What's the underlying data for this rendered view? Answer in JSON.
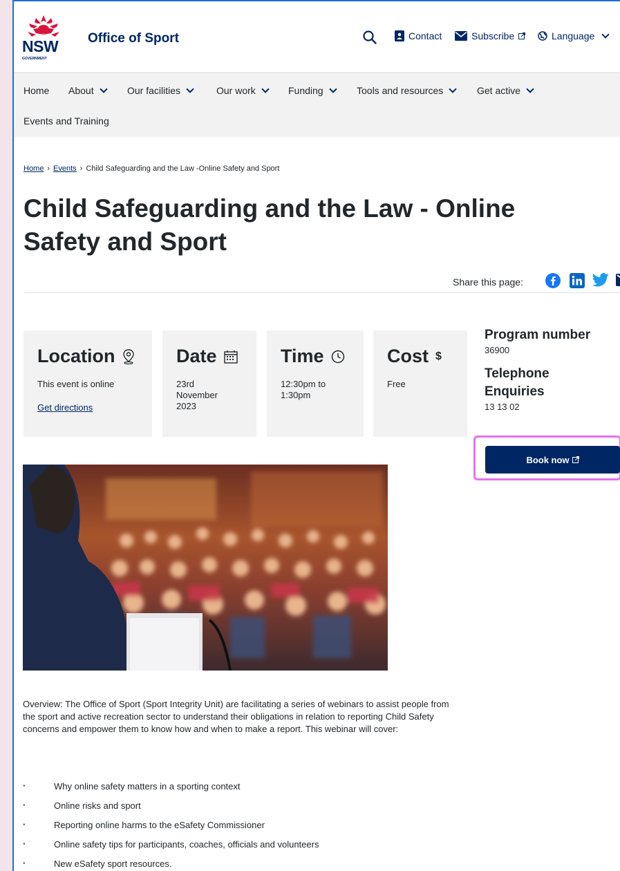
{
  "header": {
    "logo_text": "NSW",
    "logo_subtext": "GOVERNMENT",
    "site_title": "Office of Sport",
    "contact_label": "Contact",
    "subscribe_label": "Subscribe",
    "language_label": "Language"
  },
  "nav": {
    "items": [
      {
        "label": "Home"
      },
      {
        "label": "About"
      },
      {
        "label": "Our facilities"
      },
      {
        "label": "Our work"
      },
      {
        "label": "Funding"
      },
      {
        "label": "Tools and resources"
      },
      {
        "label": "Get active"
      },
      {
        "label": "Events and Training"
      }
    ]
  },
  "breadcrumb": {
    "home": "Home",
    "events": "Events",
    "current": "Child Safeguarding and the Law -Online Safety and Sport"
  },
  "page": {
    "title": "Child Safeguarding and the Law - Online Safety and Sport",
    "share_label": "Share this page:"
  },
  "cards": {
    "location": {
      "title": "Location",
      "text": "This event is online",
      "link": "Get directions"
    },
    "date": {
      "title": "Date",
      "text": "23rd November 2023"
    },
    "time": {
      "title": "Time",
      "text": "12:30pm to 1:30pm"
    },
    "cost": {
      "title": "Cost",
      "symbol": "$",
      "text": "Free"
    }
  },
  "sidebar": {
    "program_label": "Program number",
    "program_value": "36900",
    "phone_label": "Telephone Enquiries",
    "phone_value": "13 13 02",
    "book_label": "Book now"
  },
  "content": {
    "overview": "Overview: The Office of Sport (Sport Integrity Unit) are facilitating a series of webinars to assist people from the sport and active recreation sector to understand their obligations in relation to reporting Child Safety concerns and empower them to know how and when to make a report. This webinar will cover:",
    "bullets": [
      "Why online safety matters in a sporting context",
      "Online risks and sport",
      "Reporting online harms to the eSafety Commissioner",
      "Online safety tips for participants, coaches, officials and volunteers",
      "New eSafety sport resources."
    ]
  },
  "colors": {
    "brand_navy": "#002664",
    "waratah_red": "#d7153a",
    "highlight_pink": "#e86ef0"
  }
}
